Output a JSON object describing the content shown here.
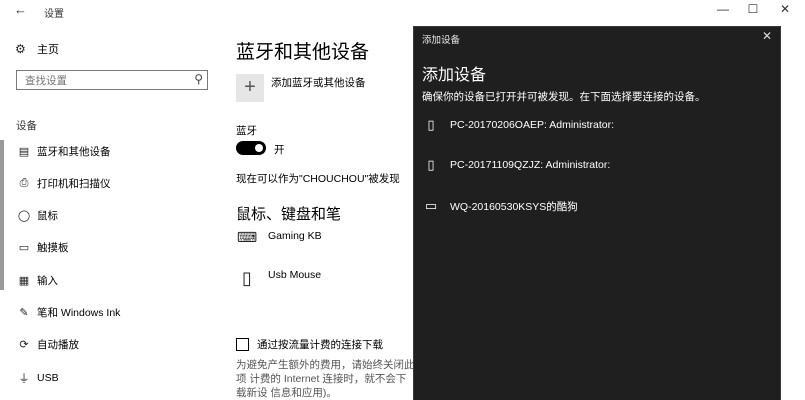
{
  "window": {
    "title": "设置",
    "back": "←",
    "minimize": "—",
    "maximize": "☐",
    "close": "✕"
  },
  "sidebar": {
    "home": "主页",
    "search_placeholder": "查找设置",
    "section": "设备",
    "items": [
      {
        "label": "蓝牙和其他设备",
        "icon": "bluetooth-devices-icon",
        "glyph": "▤"
      },
      {
        "label": "打印机和扫描仪",
        "icon": "printer-icon",
        "glyph": "⎙"
      },
      {
        "label": "鼠标",
        "icon": "mouse-icon",
        "glyph": "◯"
      },
      {
        "label": "触摸板",
        "icon": "touchpad-icon",
        "glyph": "▭"
      },
      {
        "label": "输入",
        "icon": "keyboard-icon",
        "glyph": "▦"
      },
      {
        "label": "笔和 Windows Ink",
        "icon": "pen-icon",
        "glyph": "✎"
      },
      {
        "label": "自动播放",
        "icon": "autoplay-icon",
        "glyph": "⟳"
      },
      {
        "label": "USB",
        "icon": "usb-icon",
        "glyph": "⏚"
      }
    ]
  },
  "main": {
    "title": "蓝牙和其他设备",
    "add_label": "添加蓝牙或其他设备",
    "bluetooth_label": "蓝牙",
    "toggle_state": "开",
    "discoverable": "现在可以作为\"CHOUCHOU\"被发现",
    "section_title": "鼠标、键盘和笔",
    "devices": [
      {
        "name": "Gaming KB",
        "icon": "keyboard-icon"
      },
      {
        "name": "Usb Mouse",
        "icon": "mouse-icon"
      }
    ],
    "metered_label": "通过按流量计费的连接下载",
    "metered_note": "为避免产生额外的费用，请始终关闭此项 计费的 Internet 连接时，就不会下载新设 信息和应用)。"
  },
  "dialog": {
    "title": "添加设备",
    "heading": "添加设备",
    "subtitle": "确保你的设备已打开并可被发现。在下面选择要连接的设备。",
    "devices": [
      {
        "name": "PC-20170206OAEP: Administrator:",
        "icon": "phone-icon",
        "glyph": "▯"
      },
      {
        "name": "PC-20171109QZJZ: Administrator:",
        "icon": "phone-icon",
        "glyph": "▯"
      },
      {
        "name": "WQ-20160530KSYS的酷狗",
        "icon": "monitor-icon",
        "glyph": "▭"
      }
    ]
  },
  "colors": {
    "dialog_bg": "#1f1f1f",
    "toggle_on": "#000000"
  }
}
